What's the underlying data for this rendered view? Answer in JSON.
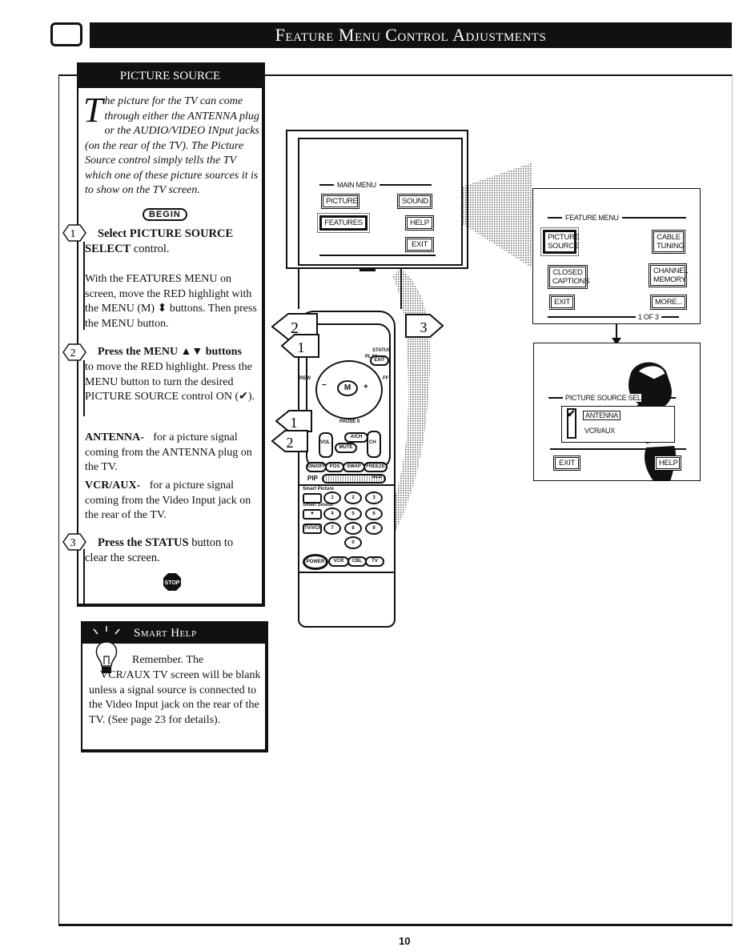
{
  "header": {
    "title": "Feature Menu Control Adjustments",
    "icon": "tv-screen-icon"
  },
  "panel": {
    "title": "PICTURE SOURCE",
    "intro_dropcap": "T",
    "intro_text": "he picture for the TV can come through either the ANTENNA plug or the AUDIO/VIDEO INput jacks (on the rear of the TV). The Picture Source control simply tells the TV which one of these picture sources it is to show on the TV screen.",
    "begin_label": "BEGIN",
    "steps": [
      {
        "number": "1",
        "heading": "Select PICTURE SOURCE",
        "heading_tail_bold": "SELECT",
        "heading_tail": " control.",
        "body": "With the FEATURES MENU on screen, move the RED highlight with the MENU (M) ⬍ buttons. Then press the MENU button."
      },
      {
        "number": "2",
        "heading": "Press the MENU ▲▼ buttons",
        "body": "to move the RED highlight. Press the MENU button to turn the desired PICTURE SOURCE control ON (✔)."
      },
      {
        "number": "3",
        "heading_bold": "Press the STATUS",
        "heading_tail": " button to clear the screen."
      }
    ],
    "options": [
      {
        "term": "ANTENNA-",
        "desc": "for a picture signal coming from the ANTENNA plug on the TV."
      },
      {
        "term": "VCR/AUX-",
        "desc": "for a picture signal coming from the Video Input jack on the rear of the TV."
      }
    ],
    "stop_label": "STOP"
  },
  "smart_help": {
    "title": "Smart Help",
    "text_line1": "Remember. The",
    "text_rest": "VCR/AUX  TV screen will be blank unless a signal source is connected to the Video Input jack on the rear of the TV. (See page 23 for details)."
  },
  "main_menu": {
    "caption": "MAIN MENU",
    "items": [
      "PICTURE",
      "SOUND",
      "FEATURES",
      "HELP",
      "EXIT"
    ],
    "highlighted": "FEATURES"
  },
  "feature_menu": {
    "caption": "FEATURE MENU",
    "items": [
      "PICTURE SOURCE",
      "CABLE TUNING",
      "CLOSED CAPTIONS",
      "CHANNEL MEMORY",
      "EXIT",
      "MORE..."
    ],
    "highlighted": "PICTURE SOURCE",
    "page_indicator": "1 OF 3"
  },
  "picture_source_screen": {
    "caption": "PICTURE SOURCE SEL",
    "options": [
      {
        "label": "ANTENNA",
        "checked": true
      },
      {
        "label": "VCR/AUX",
        "checked": false
      }
    ],
    "exit_label": "EXIT",
    "help_label": "HELP"
  },
  "remote": {
    "callouts": [
      "2",
      "1",
      "3",
      "1",
      "2"
    ],
    "labels": {
      "play": "PLAY ▸",
      "status": "STATUS",
      "exit": "EXIT",
      "rew": "REW",
      "ff": "FF",
      "menu": "M",
      "pause": "PAUSE II",
      "vol": "VOL",
      "ach": "A/CH",
      "mute": "MUTE",
      "ch": "CH",
      "pip": "PIP",
      "size": "SIZE",
      "smart_picture": "Smart Picture",
      "smart_sound": "Smart Sound",
      "tvvcr": "TV/VCR",
      "power": "POWER",
      "vcr": "VCR",
      "cbl": "CBL",
      "tv": "TV"
    },
    "pip_buttons": [
      "ON/OFF",
      "POS",
      "SWAP",
      "FREEZE"
    ],
    "number_keys": [
      "1",
      "2",
      "3",
      "4",
      "5",
      "6",
      "7",
      "8",
      "9",
      "0"
    ]
  },
  "footer": {
    "page_number": "10"
  }
}
